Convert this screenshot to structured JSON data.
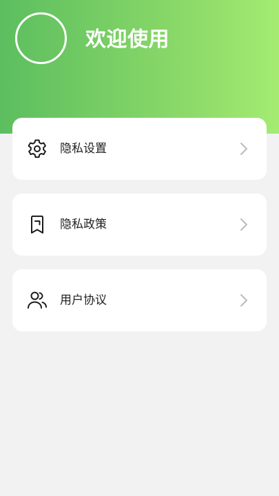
{
  "header": {
    "welcome_text": "欢迎使用",
    "gradient_start": "#5cbe5f",
    "gradient_end": "#a4ec72"
  },
  "menu": {
    "items": [
      {
        "label": "隐私设置",
        "icon": "gear-icon"
      },
      {
        "label": "隐私政策",
        "icon": "bookmark-icon"
      },
      {
        "label": "用户协议",
        "icon": "users-icon"
      }
    ]
  },
  "colors": {
    "background": "#f2f2f2",
    "card": "#ffffff",
    "chevron": "#bbbbbb",
    "text": "#222222"
  }
}
